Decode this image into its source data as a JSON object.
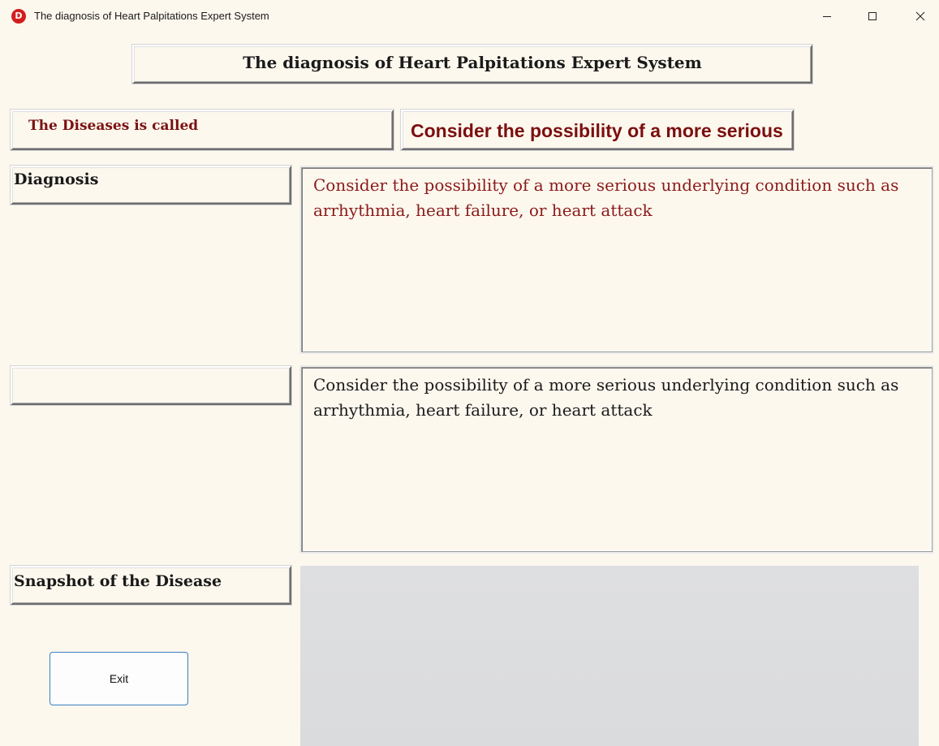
{
  "window": {
    "title": "The diagnosis of Heart Palpitations Expert System",
    "app_icon_letter": "D",
    "app_icon_color": "#d21e1e",
    "controls": [
      "minimize-icon",
      "maximize-icon",
      "close-icon"
    ]
  },
  "header": {
    "title": "The diagnosis of Heart Palpitations Expert System"
  },
  "disease": {
    "label": "The Diseases is called",
    "name": "Consider the possibility of a more serious underlying condition such as arrhythmia, heart failure, or heart attack"
  },
  "diagnosis": {
    "label": "Diagnosis",
    "text": "Consider the possibility of a more serious underlying condition such as arrhythmia, heart failure, or heart attack"
  },
  "second_panel": {
    "label": "",
    "text": "Consider the possibility of a more serious underlying condition such as arrhythmia, heart failure, or heart attack"
  },
  "snapshot": {
    "label": "Snapshot of the Disease"
  },
  "actions": {
    "exit_label": "Exit"
  },
  "colors": {
    "background": "#fdf8ee",
    "accent_dark_red": "#7b0f0f",
    "diagnosis_text": "#8b1a1a",
    "button_border": "#3a7fc1"
  }
}
